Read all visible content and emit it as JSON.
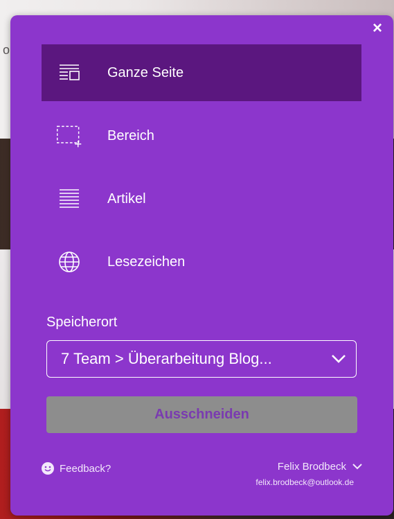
{
  "background": {
    "partial_char": "o"
  },
  "clipper": {
    "close_label": "×",
    "modes": [
      {
        "label": "Ganze Seite",
        "icon": "full-page-icon",
        "selected": true
      },
      {
        "label": "Bereich",
        "icon": "region-icon",
        "selected": false
      },
      {
        "label": "Artikel",
        "icon": "article-icon",
        "selected": false
      },
      {
        "label": "Lesezeichen",
        "icon": "bookmark-globe-icon",
        "selected": false
      }
    ],
    "location": {
      "label": "Speicherort",
      "value": "7 Team > Überarbeitung Blog..."
    },
    "clip_button_label": "Ausschneiden",
    "feedback_label": "Feedback?",
    "user": {
      "name": "Felix Brodbeck",
      "email": "felix.brodbeck@outlook.de"
    },
    "colors": {
      "panel": "#8c36cc",
      "selected": "#5b177f",
      "button_disabled": "#8d8d8d"
    }
  }
}
